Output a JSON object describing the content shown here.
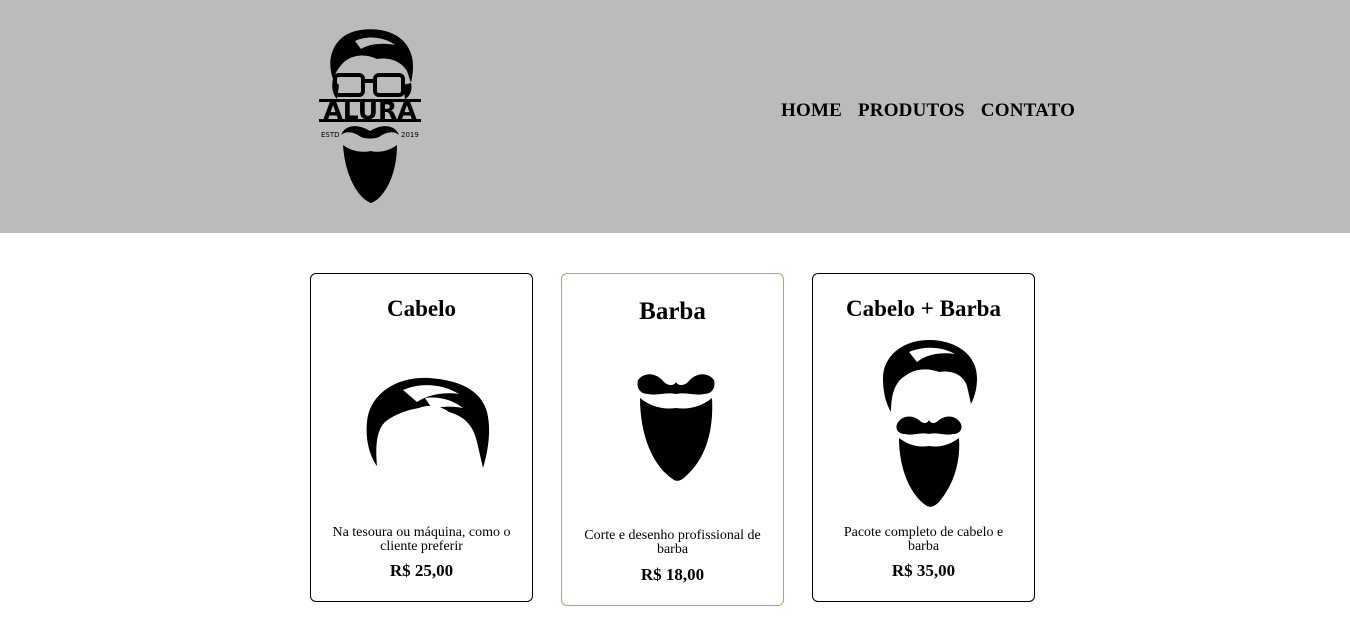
{
  "logo": {
    "text": "ALURA",
    "estd_left": "ESTD",
    "estd_right": "2019",
    "icon": "bearded-man-glasses-logo"
  },
  "nav": {
    "items": [
      "HOME",
      "PRODUTOS",
      "CONTATO"
    ]
  },
  "products": [
    {
      "title": "Cabelo",
      "description": "Na tesoura ou máquina, como o cliente preferir",
      "price": "R$ 25,00",
      "icon": "hair-icon"
    },
    {
      "title": "Barba",
      "description": "Corte e desenho profissional de barba",
      "price": "R$ 18,00",
      "icon": "beard-icon"
    },
    {
      "title": "Cabelo + Barba",
      "description": "Pacote completo de cabelo e barba",
      "price": "R$ 35,00",
      "icon": "hair-and-beard-icon"
    }
  ],
  "colors": {
    "header_bg": "#bbbbbb",
    "hover_border": "#c9a24a",
    "text": "#000000"
  }
}
